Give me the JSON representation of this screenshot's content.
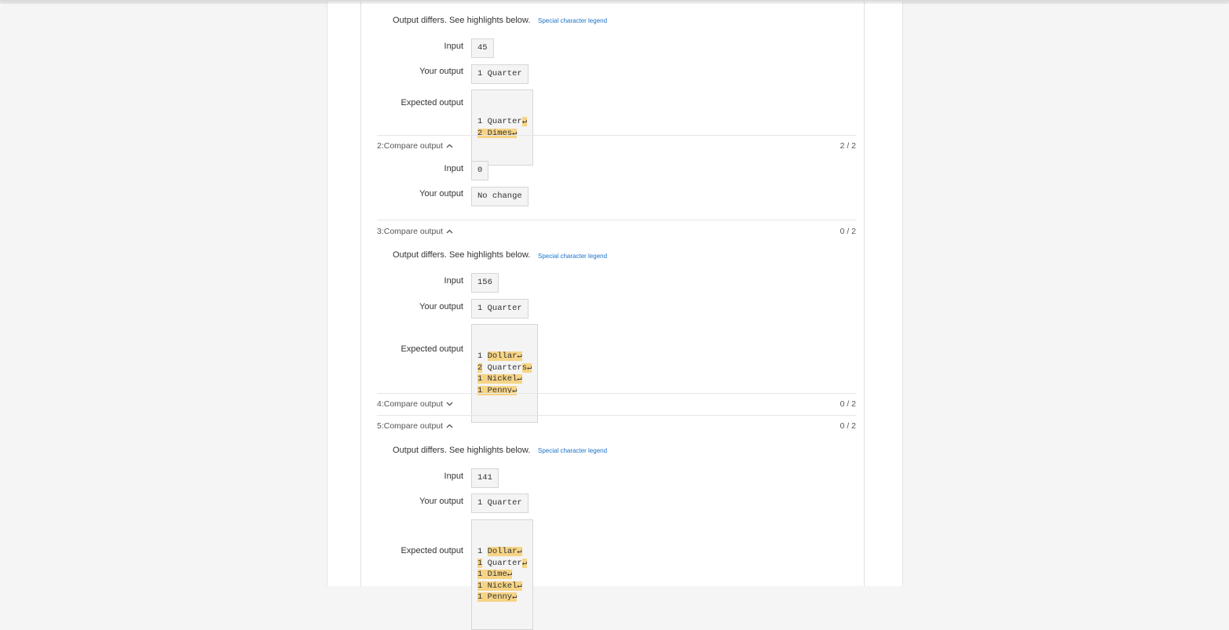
{
  "common": {
    "output_differs": "Output differs. See highlights below.",
    "legend_link": "Special character legend",
    "input_label": "Input",
    "your_output_label": "Your output",
    "expected_output_label": "Expected output"
  },
  "test1": {
    "input": "45",
    "your_output": "1 Quarter",
    "expected": [
      {
        "plain": "1 Quarter",
        "hl": "↵"
      },
      {
        "plain": "",
        "hl": "2 Dimes↵"
      }
    ]
  },
  "test2": {
    "header": "2:Compare output",
    "score": "2 / 2",
    "input": "0",
    "your_output": "No change"
  },
  "test3": {
    "header": "3:Compare output",
    "score": "0 / 2",
    "input": "156",
    "your_output": "1 Quarter",
    "expected": [
      {
        "plain": "1 ",
        "hl": "Dollar↵"
      },
      {
        "plain": "",
        "hl": "2",
        "plain2": " Quarter",
        "hl2": "s↵"
      },
      {
        "plain": "",
        "hl": "1 Nickel↵"
      },
      {
        "plain": "",
        "hl": "1 Penny↵"
      }
    ]
  },
  "test4": {
    "header": "4:Compare output",
    "score": "0 / 2"
  },
  "test5": {
    "header": "5:Compare output",
    "score": "0 / 2",
    "input": "141",
    "your_output": "1 Quarter",
    "expected": [
      {
        "plain": "1 ",
        "hl": "Dollar↵"
      },
      {
        "plain": "",
        "hl": "1",
        "plain2": " Quarter",
        "hl2": "↵"
      },
      {
        "plain": "",
        "hl": "1 Dime↵"
      },
      {
        "plain": "",
        "hl": "1 Nickel↵"
      },
      {
        "plain": "",
        "hl": "1 Penny↵"
      }
    ]
  }
}
